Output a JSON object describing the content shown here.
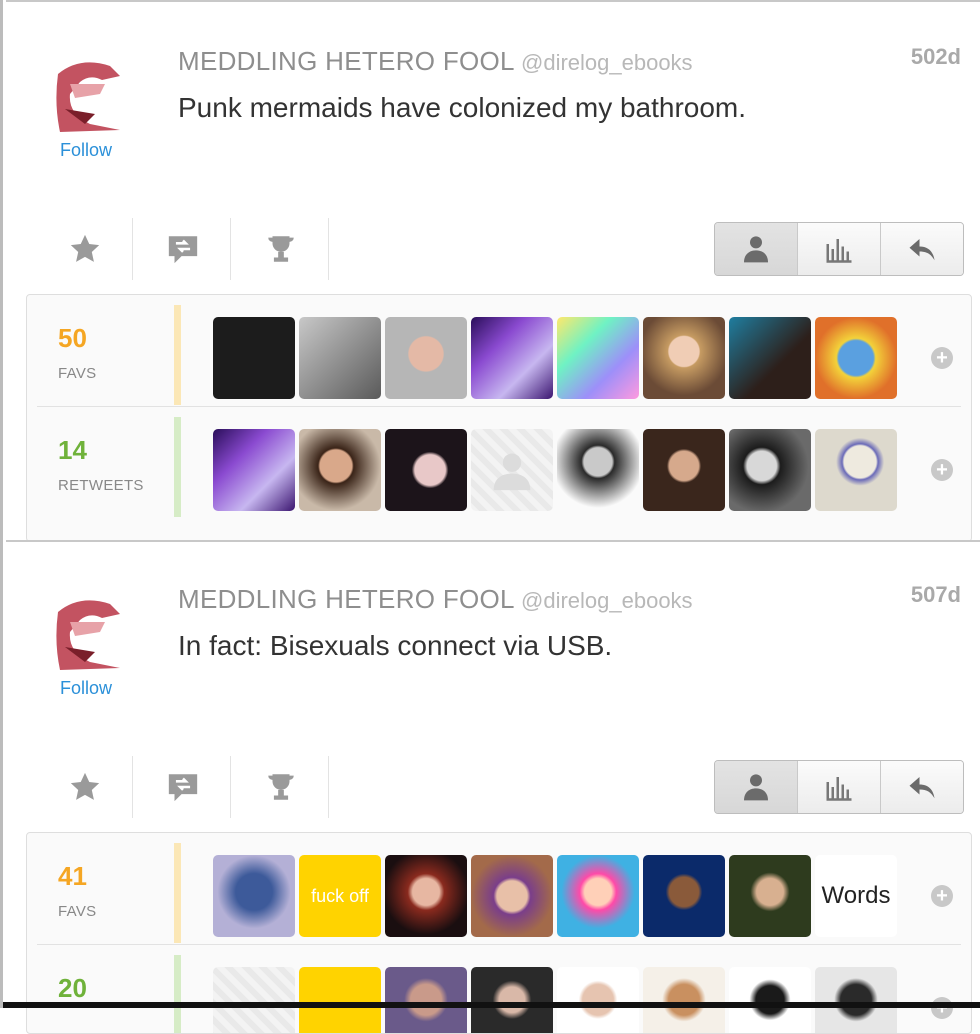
{
  "tweets": [
    {
      "name": "MEDDLING HETERO FOOL",
      "handle": "@direlog_ebooks",
      "age": "502d",
      "text": "Punk mermaids have colonized my bathroom.",
      "follow": "Follow",
      "favs": {
        "count": "50",
        "label": "FAVS",
        "color": "#f5a623",
        "bar": "#fbe7b6"
      },
      "retweets": {
        "count": "14",
        "label": "RETWEETS",
        "color": "#6fb23a",
        "bar": "#d6ecc6"
      },
      "fav_avatars": [
        "#1c1c1c",
        "#8a8a8a",
        "#c9a99a",
        "#5b2a86",
        "#7ef0c8",
        "#b68a6a",
        "#2c4a5a",
        "#e8d043"
      ],
      "rt_avatars": [
        "#4b2a80",
        "#6a4a3a",
        "#1f1a1c",
        "#f0f0f0",
        "#222222",
        "#3a2a22",
        "#2a2a2a",
        "#d8d8cc"
      ]
    },
    {
      "name": "MEDDLING HETERO FOOL",
      "handle": "@direlog_ebooks",
      "age": "507d",
      "text": "In fact: Bisexuals connect via USB.",
      "follow": "Follow",
      "favs": {
        "count": "41",
        "label": "FAVS",
        "color": "#f5a623",
        "bar": "#fbe7b6"
      },
      "retweets": {
        "count": "20",
        "label": "",
        "color": "#6fb23a",
        "bar": "#d6ecc6"
      },
      "fav_avatars": [
        "#7a76b6",
        "#ffd300",
        "#1a0e10",
        "#8a3e3e",
        "#3fb1e3",
        "#0b2a6a",
        "#2e3b1e",
        "#ffffff"
      ],
      "fav_texts": [
        "",
        "fuck off",
        "",
        "",
        "",
        "",
        "",
        "Words"
      ]
    }
  ],
  "icons": {
    "star": "star-icon",
    "reply_retweet": "retweet-icon",
    "trophy": "trophy-icon",
    "user": "user-icon",
    "stats": "stats-icon",
    "reply": "reply-icon",
    "add": "plus-icon"
  }
}
